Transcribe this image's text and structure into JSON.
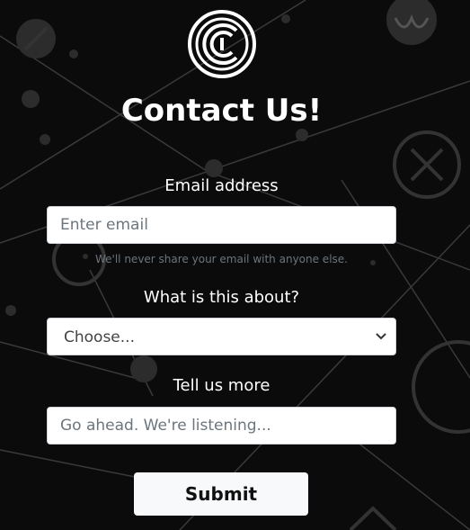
{
  "colors": {
    "background": "#0b0b0b",
    "text": "#ffffff",
    "muted": "#6c757d",
    "button": "#f8f9fa"
  },
  "logo": {
    "icon": "coin-logo-icon"
  },
  "page_title": "Contact Us!",
  "email": {
    "label": "Email address",
    "placeholder": "Enter email",
    "value": "",
    "help": "We'll never share your email with anyone else."
  },
  "topic": {
    "label": "What is this about?",
    "selected": "Choose...",
    "icon": "chevron-down-icon"
  },
  "message": {
    "label": "Tell us more",
    "placeholder": "Go ahead. We're listening...",
    "value": ""
  },
  "submit_label": "Submit"
}
